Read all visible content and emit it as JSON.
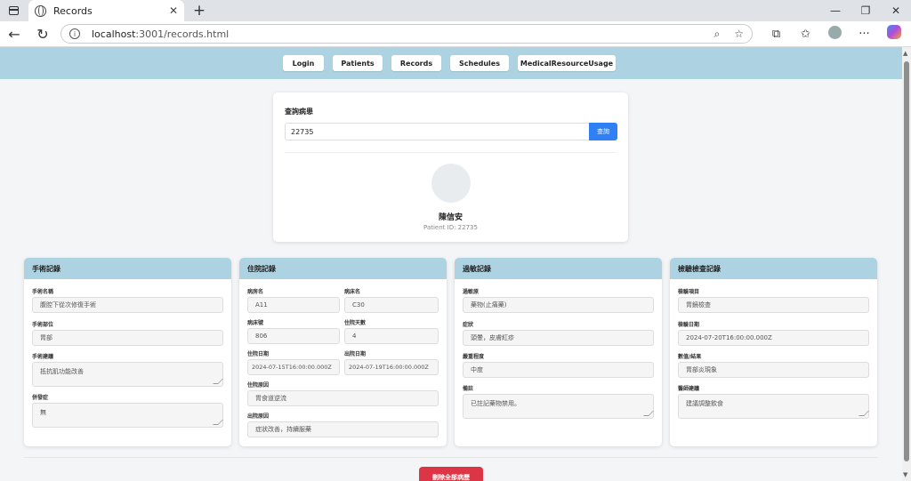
{
  "browser": {
    "tab_title": "Records",
    "url_host": "localhost",
    "url_path": ":3001/records.html"
  },
  "nav": [
    "Login",
    "Patients",
    "Records",
    "Schedules",
    "MedicalResourceUsage"
  ],
  "search": {
    "label": "查詢病患",
    "value": "22735",
    "button": "查詢"
  },
  "patient": {
    "name": "陳信安",
    "id_text": "Patient ID: 22735"
  },
  "surgery": {
    "title": "手術記錄",
    "name_label": "手術名稱",
    "name_value": "腹腔下從次修復手術",
    "site_label": "手術部位",
    "site_value": "胃部",
    "advice_label": "手術建議",
    "advice_value": "抵抗肌功能改善",
    "complication_label": "併發症",
    "complication_value": "無"
  },
  "hospital": {
    "title": "住院記錄",
    "ward_label": "病房名",
    "ward_value": "A11",
    "bed_label": "病床名",
    "bed_value": "C30",
    "bedno_label": "病床號",
    "bedno_value": "806",
    "days_label": "住院天數",
    "days_value": "4",
    "in_label": "住院日期",
    "in_value": "2024-07-15T16:00:00.000Z",
    "out_label": "出院日期",
    "out_value": "2024-07-19T16:00:00.000Z",
    "reason_in_label": "住院原因",
    "reason_in_value": "胃食道逆流",
    "reason_out_label": "出院原因",
    "reason_out_value": "症狀改善，持續服藥"
  },
  "allergy": {
    "title": "過敏記錄",
    "source_label": "過敏原",
    "source_value": "藥物(止痛藥)",
    "symptom_label": "症狀",
    "symptom_value": "頭暈，皮膚紅疹",
    "severity_label": "嚴重程度",
    "severity_value": "中度",
    "note_label": "備註",
    "note_value": "已註記藥物禁用。"
  },
  "exam": {
    "title": "檢驗檢查記錄",
    "item_label": "檢驗項目",
    "item_value": "胃鏡檢查",
    "date_label": "檢驗日期",
    "date_value": "2024-07-20T16:00:00.000Z",
    "result_label": "數值/結果",
    "result_value": "胃部炎現象",
    "advice_label": "醫師建議",
    "advice_value": "建議調整飲食"
  },
  "delete_button": "刪除全部病歷"
}
